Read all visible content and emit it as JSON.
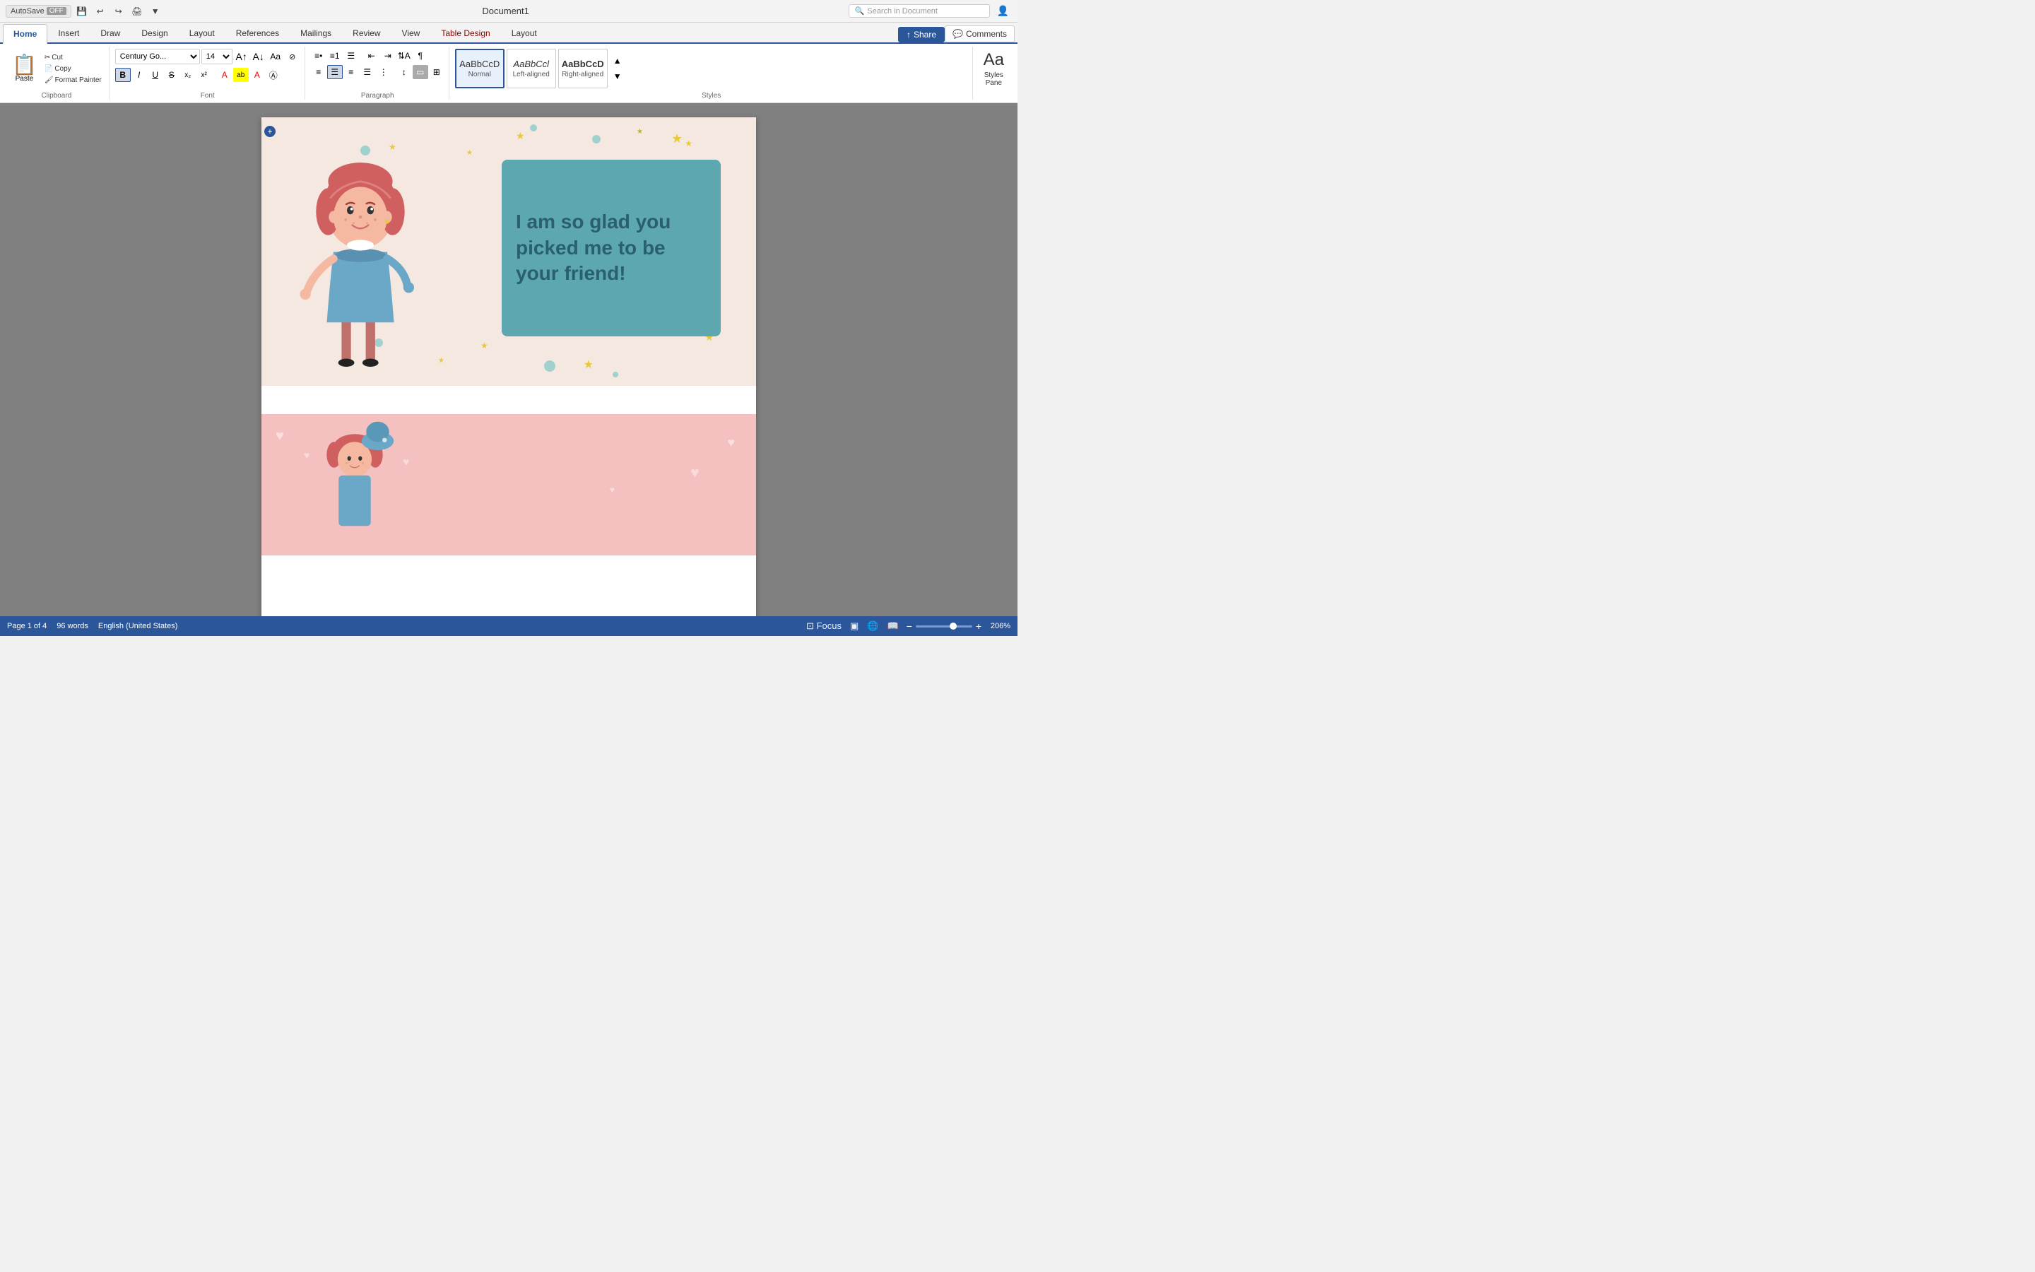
{
  "titleBar": {
    "autosave": "AutoSave",
    "autosave_state": "OFF",
    "title": "Document1",
    "search_placeholder": "Search in Document"
  },
  "ribbonTabs": [
    {
      "label": "Home",
      "active": true
    },
    {
      "label": "Insert",
      "active": false
    },
    {
      "label": "Draw",
      "active": false
    },
    {
      "label": "Design",
      "active": false
    },
    {
      "label": "Layout",
      "active": false
    },
    {
      "label": "References",
      "active": false
    },
    {
      "label": "Mailings",
      "active": false
    },
    {
      "label": "Review",
      "active": false
    },
    {
      "label": "View",
      "active": false
    },
    {
      "label": "Table Design",
      "active": false,
      "highlight": "table"
    },
    {
      "label": "Layout",
      "active": false,
      "extra": true
    }
  ],
  "actions": {
    "share_label": "Share",
    "comments_label": "Comments"
  },
  "toolbar": {
    "paste_label": "Paste",
    "font_name": "Century Go...",
    "font_size": "14",
    "bold": "B",
    "italic": "I",
    "underline": "U",
    "strikethrough": "S",
    "subscript": "x₂",
    "superscript": "x²"
  },
  "styles": [
    {
      "name": "Normal",
      "preview": "AaBbCcD",
      "selected": true
    },
    {
      "name": "Left-aligned",
      "preview": "AaBbCcl",
      "selected": false
    },
    {
      "name": "Right-aligned",
      "preview": "AaBbCcD",
      "selected": false
    }
  ],
  "stylesPane": {
    "label": "Styles\nPane"
  },
  "card1": {
    "text": "I am so glad you picked me to be your friend!"
  },
  "statusBar": {
    "page_label": "Page 1 of 4",
    "words_label": "96 words",
    "language": "English (United States)",
    "zoom_percent": "206%"
  }
}
